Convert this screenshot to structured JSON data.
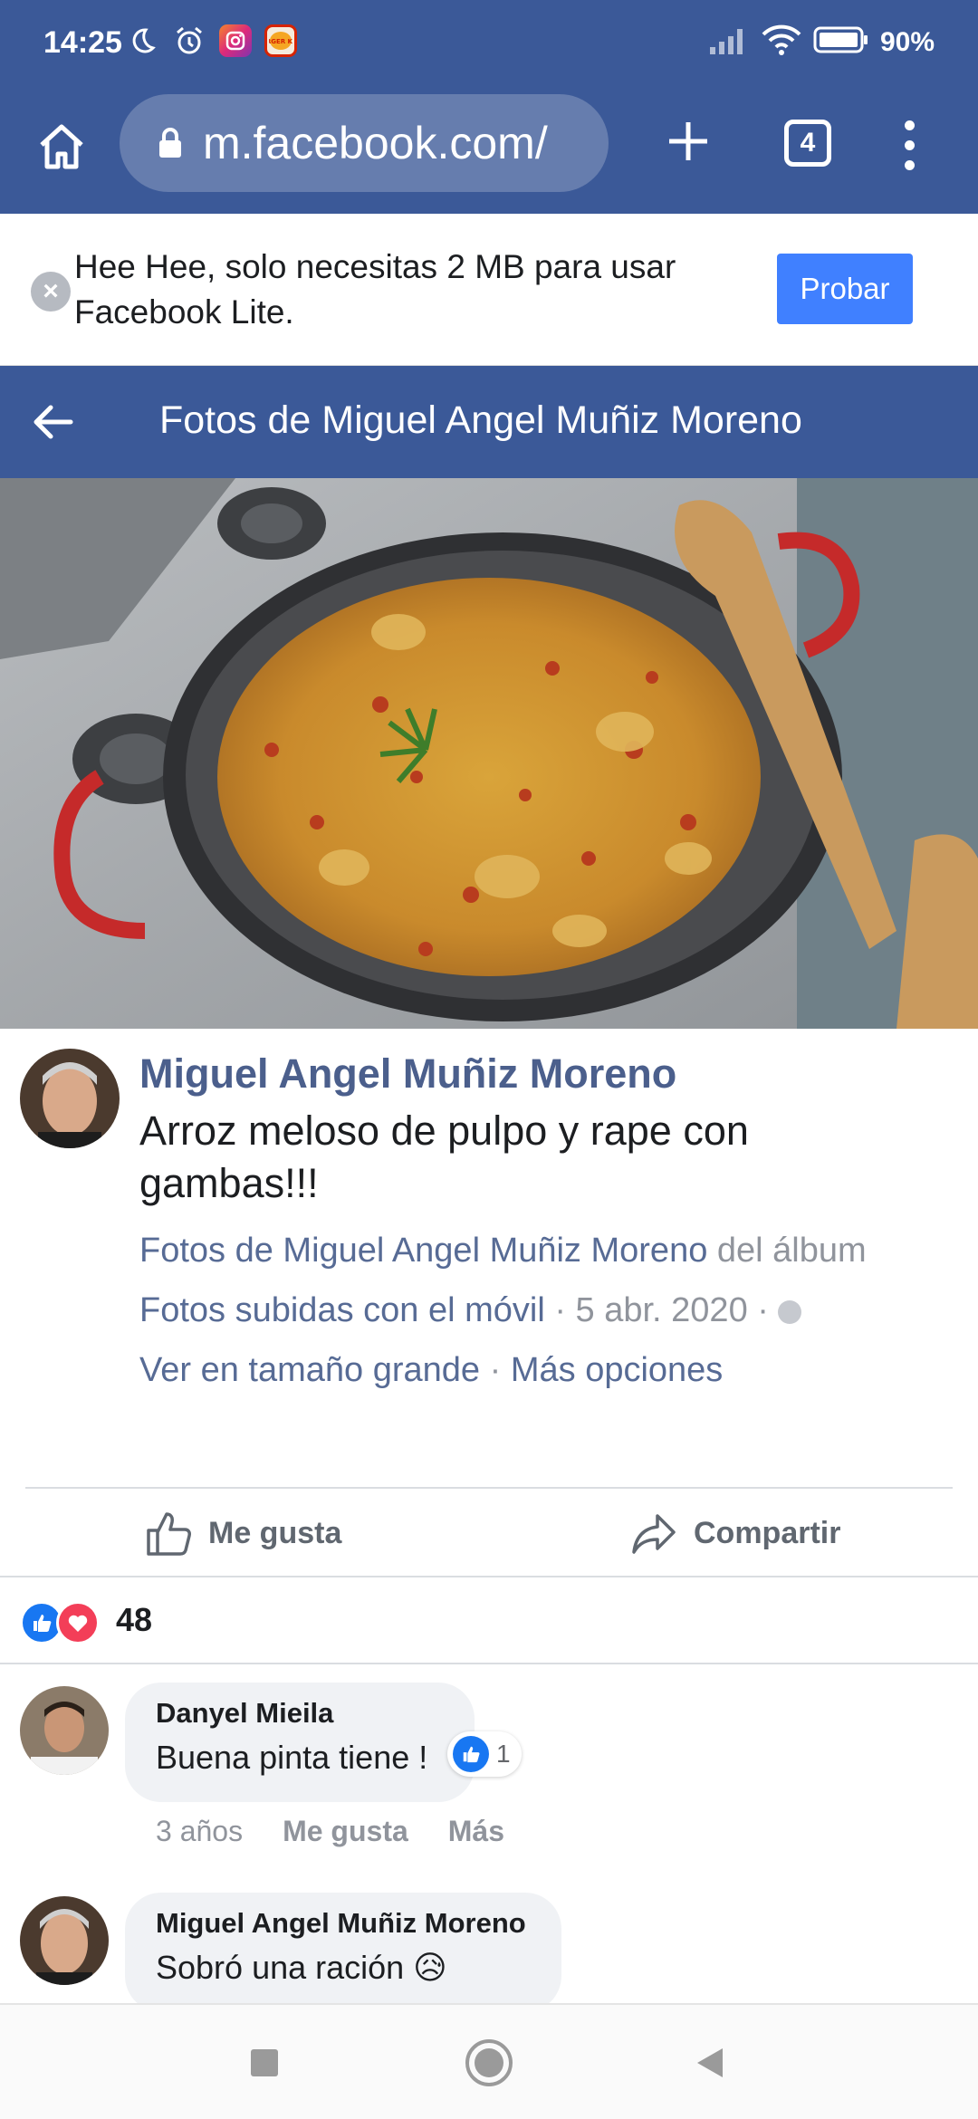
{
  "status_bar": {
    "time": "14:25",
    "battery": "90%",
    "icons": [
      "moon-icon",
      "alarm-icon",
      "instagram-icon",
      "burger-king-icon",
      "signal-icon",
      "wifi-icon",
      "battery-icon"
    ],
    "bk_label": "BURGER KING"
  },
  "browser": {
    "url": "m.facebook.com/",
    "tab_count": "4"
  },
  "lite_banner": {
    "text": "Hee Hee, solo necesitas 2 MB para usar Facebook Lite.",
    "button": "Probar"
  },
  "header": {
    "title": "Fotos de Miguel Angel Muñiz Moreno"
  },
  "post": {
    "author": "Miguel Angel Muñiz Moreno",
    "caption": "Arroz meloso de pulpo y rape con gambas!!!",
    "album_link": "Fotos de Miguel Angel Muñiz Moreno",
    "album_prefix": " del álbum",
    "album_name": "Fotos subidas con el móvil",
    "date": " · 5 abr. 2020 · ",
    "view_large": "Ver en tamaño grande",
    "sep": " · ",
    "more_options": "Más opciones"
  },
  "actions": {
    "like": "Me gusta",
    "share": "Compartir"
  },
  "reactions": {
    "count": "48"
  },
  "comments": [
    {
      "name": "Danyel Mieila",
      "text": "Buena pinta tiene !",
      "reaction_count": "1",
      "time": "3 años",
      "like": "Me gusta",
      "more": "Más"
    },
    {
      "name": "Miguel Angel Muñiz Moreno",
      "text": "Sobró una ración 😥"
    }
  ],
  "colors": {
    "facebook_blue": "#3b5998",
    "link_blue": "#576b95",
    "button_blue": "#4080ff",
    "like_blue": "#1877f2",
    "love_red": "#f33e58"
  }
}
